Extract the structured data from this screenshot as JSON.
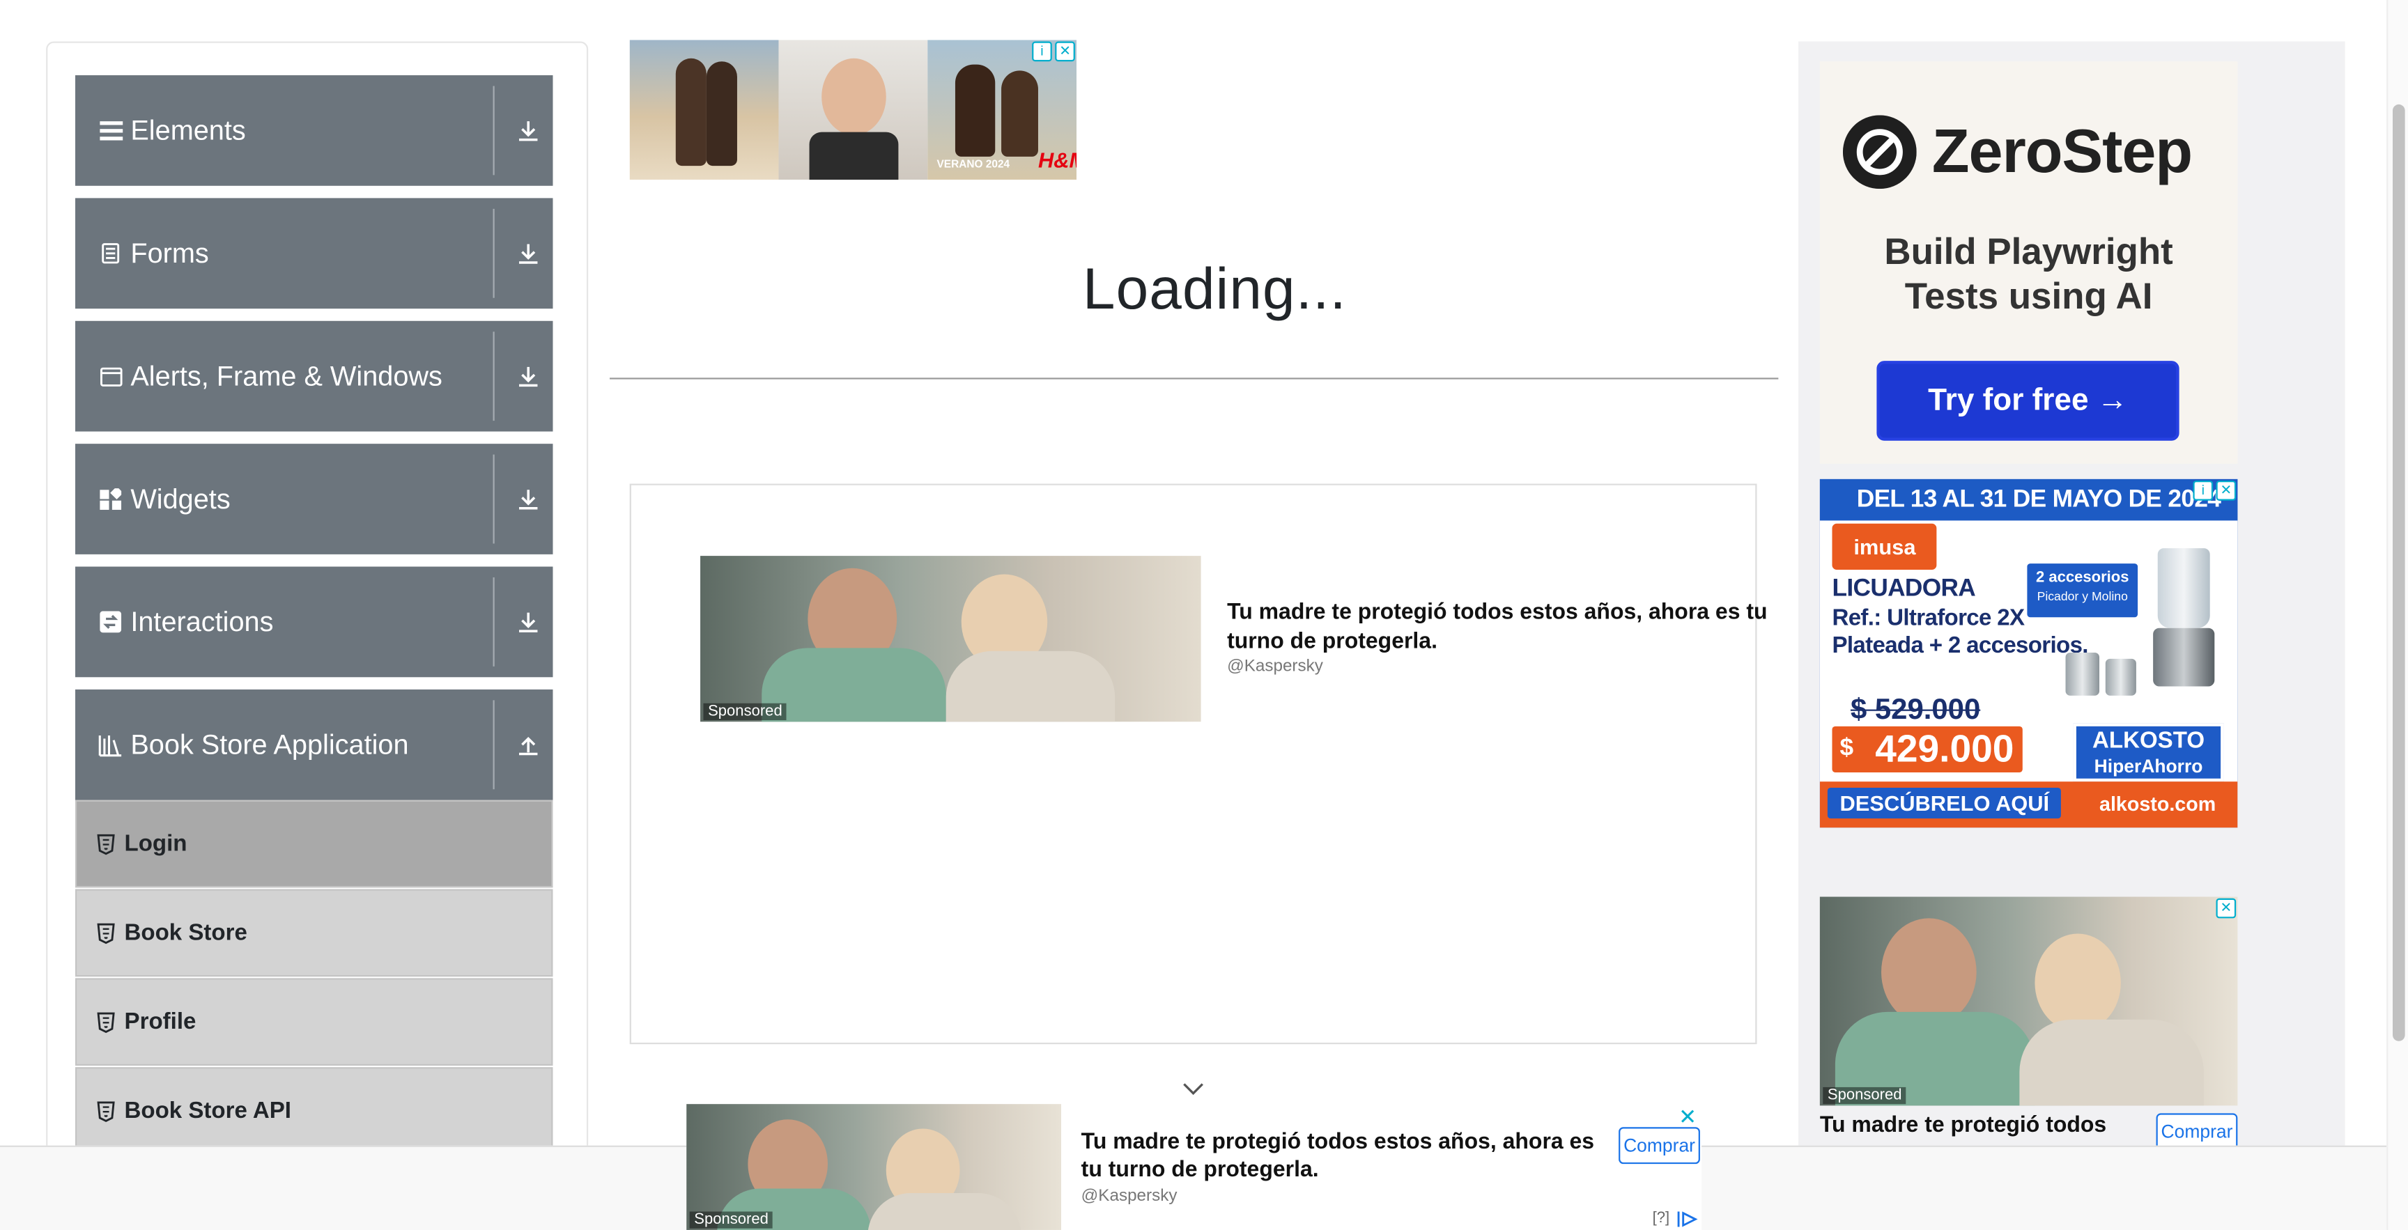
{
  "sidebar": {
    "groups": [
      {
        "label": "Elements",
        "icon": "list-icon",
        "expanded": false
      },
      {
        "label": "Forms",
        "icon": "form-icon",
        "expanded": false
      },
      {
        "label": "Alerts, Frame & Windows",
        "icon": "window-icon",
        "expanded": false
      },
      {
        "label": "Widgets",
        "icon": "widgets-icon",
        "expanded": false
      },
      {
        "label": "Interactions",
        "icon": "interactions-icon",
        "expanded": false
      },
      {
        "label": "Book Store Application",
        "icon": "books-icon",
        "expanded": true
      }
    ],
    "items": [
      {
        "label": "Login",
        "active": true
      },
      {
        "label": "Book Store",
        "active": false
      },
      {
        "label": "Profile",
        "active": false
      },
      {
        "label": "Book Store API",
        "active": false
      }
    ]
  },
  "main": {
    "loading_text": "Loading..."
  },
  "ads": {
    "top_banner": {
      "text": "VERANO 2024",
      "brand": "H&M"
    },
    "native_center": {
      "sponsored": "Sponsored",
      "headline": "Tu madre te protegió todos estos años, ahora es tu turno de protegerla.",
      "handle": "@Kaspersky"
    },
    "zerostep": {
      "brand": "ZeroStep",
      "tagline_1": "Build Playwright",
      "tagline_2": "Tests using AI",
      "cta": "Try for free →"
    },
    "alkosto": {
      "date_line": "DEL 13 AL 31 DE MAYO DE 2024",
      "brand": "imusa",
      "product": "LICUADORA",
      "ref_line": "Ref.: Ultraforce 2X",
      "desc_line": "Plateada + 2 accesorios.",
      "acc_title": "2 accesorios",
      "acc_sub": "Picador y Molino",
      "old_price": "$ 529.000",
      "currency": "$",
      "new_price": "429.000",
      "store": "ALKOSTO",
      "store_sub": "HiperAhorro",
      "cta": "DESCÚBRELO AQUÍ",
      "url": "alkosto.com"
    },
    "native_right": {
      "sponsored": "Sponsored",
      "headline": "Tu madre te protegió todos",
      "buy": "Comprar"
    },
    "bottom_sticky": {
      "sponsored": "Sponsored",
      "headline": "Tu madre te protegió todos estos años, ahora es tu turno de protegerla.",
      "handle": "@Kaspersky",
      "buy": "Comprar",
      "meta": "[?]"
    },
    "info_badge": "i",
    "close_glyph": "✕"
  },
  "colors": {
    "sidebar_group_bg": "#6c757d",
    "sidebar_item_bg": "#d3d3d3",
    "sidebar_item_active_bg": "#a9a9a9",
    "zerostep_button": "#1d39d3",
    "alkosto_blue": "#1e5bc6",
    "alkosto_orange": "#ea5a1f",
    "ad_close": "#00aecd"
  }
}
